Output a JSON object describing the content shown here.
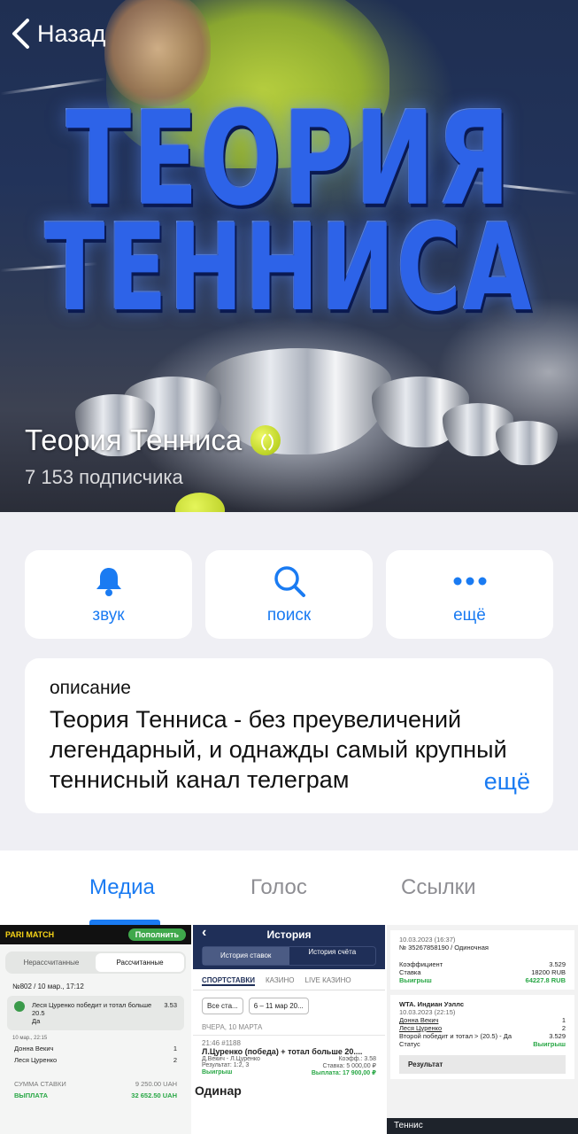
{
  "nav": {
    "back_label": "Назад"
  },
  "hero": {
    "logo_line1": "ТЕОРИЯ",
    "logo_line2": "ТЕННИСА"
  },
  "channel": {
    "title": "Теория Тенниса",
    "title_emoji": "tennis-ball-icon",
    "subscribers": "7 153 подписчика"
  },
  "actions": [
    {
      "label": "звук",
      "icon": "bell-icon"
    },
    {
      "label": "поиск",
      "icon": "search-icon"
    },
    {
      "label": "ещё",
      "icon": "more-icon"
    }
  ],
  "description": {
    "label": "описание",
    "text": "Теория Тенниса - без преувеличений легендарный, и однажды самый крупный теннисный канал телеграм",
    "more_label": "ещё"
  },
  "tabs": [
    {
      "label": "Медиа",
      "active": true
    },
    {
      "label": "Голос",
      "active": false
    },
    {
      "label": "Ссылки",
      "active": false
    }
  ],
  "colors": {
    "accent": "#1a7bf2",
    "background": "#efeff4"
  },
  "media": {
    "item1": {
      "brand": "PARI MATCH",
      "topup": "Пополнить",
      "seg_left": "Нерассчитанные",
      "seg_right": "Рассчитанные",
      "bet_id": "№802 / 10 мар., 17:12",
      "bet_text": "Леся Цуренко победит и тотал больше 20.5",
      "bet_answer": "Да",
      "bet_odds": "3.53",
      "match_time": "10 мар., 22:15",
      "p1": "Донна Векич",
      "p1_score": "1",
      "p2": "Леся Цуренко",
      "p2_score": "2",
      "stake_label": "СУММА СТАВКИ",
      "stake": "9 250.00 UAH",
      "payout_label": "ВЫПЛАТА",
      "payout": "32 652.50 UAH"
    },
    "item2": {
      "title": "История",
      "sw_left": "История ставок",
      "sw_right": "История счёта",
      "tab1": "СПОРТСТАВКИ",
      "tab2": "КАЗИНО",
      "tab3": "LIVE КАЗИНО",
      "filter1": "Все ста...",
      "filter2": "6 – 11 мар 20...",
      "date": "ВЧЕРА, 10 МАРТА",
      "time": "21:46  #1188",
      "bet": "Л.Цуренко (победа) + тотал больше 20....",
      "match": "Д.Векич - Л.Цуренко",
      "coef": "Коэфф.: 3.58",
      "result": "Результат: 1:2, 3",
      "stake": "Ставка: 5 000,00 ₽",
      "status": "Выигрыш",
      "payout": "Выплата: 17 900,00 ₽",
      "type": "Одинар"
    },
    "item3": {
      "ts": "10.03.2023 (16:37)",
      "id": "№ 35267858190 / Одиночная",
      "coef_label": "Коэффициент",
      "coef": "3.529",
      "stake_label": "Ставка",
      "stake": "18200 RUB",
      "win_label": "Выигрыш",
      "win": "64227.8 RUB",
      "league": "WTA. Индиан Уэллс",
      "ts2": "10.03.2023 (22:15)",
      "p1": "Донна Векич",
      "p1_score": "1",
      "p2": "Леся Цуренко",
      "p2_score": "2",
      "market": "Второй победит и тотал > (20.5) - Да",
      "market_odds": "3.529",
      "status_label": "Статус",
      "status": "Выигрыш",
      "result_label": "Результат",
      "bottom": "Теннис"
    }
  }
}
